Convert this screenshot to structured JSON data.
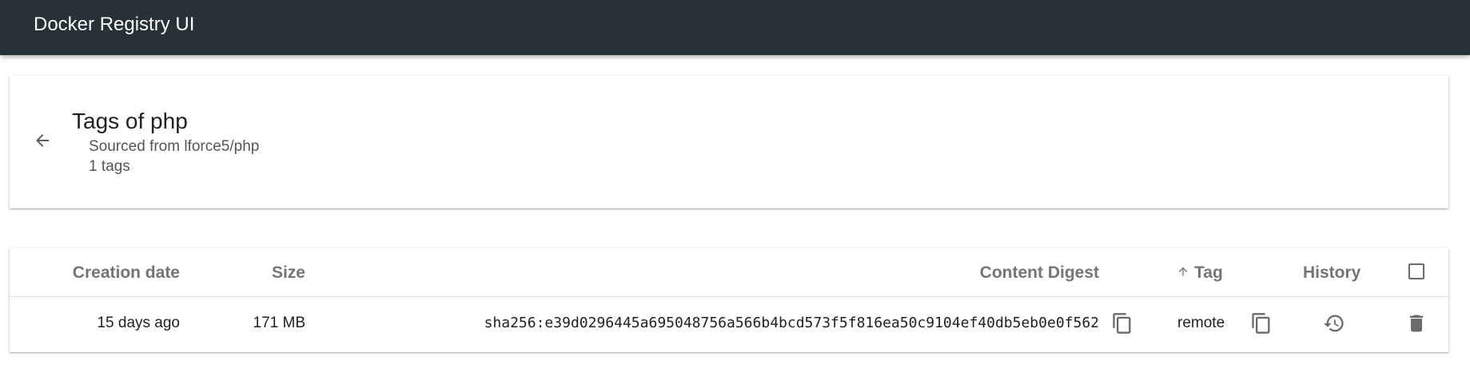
{
  "app": {
    "title": "Docker Registry UI"
  },
  "header": {
    "title": "Tags of php",
    "source": "Sourced from lforce5/php",
    "tag_count": "1 tags"
  },
  "table": {
    "columns": {
      "creation_date": "Creation date",
      "size": "Size",
      "content_digest": "Content Digest",
      "tag": "Tag",
      "history": "History"
    },
    "sort": {
      "column": "tag",
      "direction": "ascending"
    },
    "rows": [
      {
        "creation_date": "15 days ago",
        "size": "171 MB",
        "content_digest": "sha256:e39d0296445a695048756a566b4bcd573f5f816ea50c9104ef40db5eb0e0f562",
        "tag": "remote",
        "selected": false
      }
    ]
  },
  "icons": {
    "back": "arrow-back-icon",
    "copy": "copy-icon",
    "history": "history-icon",
    "delete": "delete-icon",
    "sort": "arrow-up-icon"
  },
  "colors": {
    "app_bar": "#263238",
    "header_text": "#757575",
    "icon": "#6b6b6b"
  }
}
